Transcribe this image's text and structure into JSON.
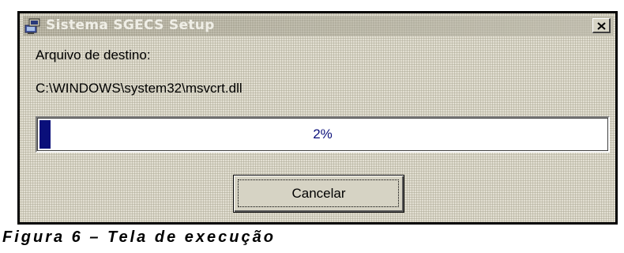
{
  "window": {
    "title": "Sistema SGECS Setup",
    "app_icon": "setup-computer-icon",
    "close_icon": "close-x-icon"
  },
  "destination_label": "Arquivo de destino:",
  "file_path": "C:\\WINDOWS\\system32\\msvcrt.dll",
  "progress": {
    "fraction": 0.02,
    "text": "2%",
    "color": "#0a0f7a"
  },
  "cancel_button": {
    "label": "Cancelar"
  },
  "caption": "Figura 6 – Tela de execução"
}
